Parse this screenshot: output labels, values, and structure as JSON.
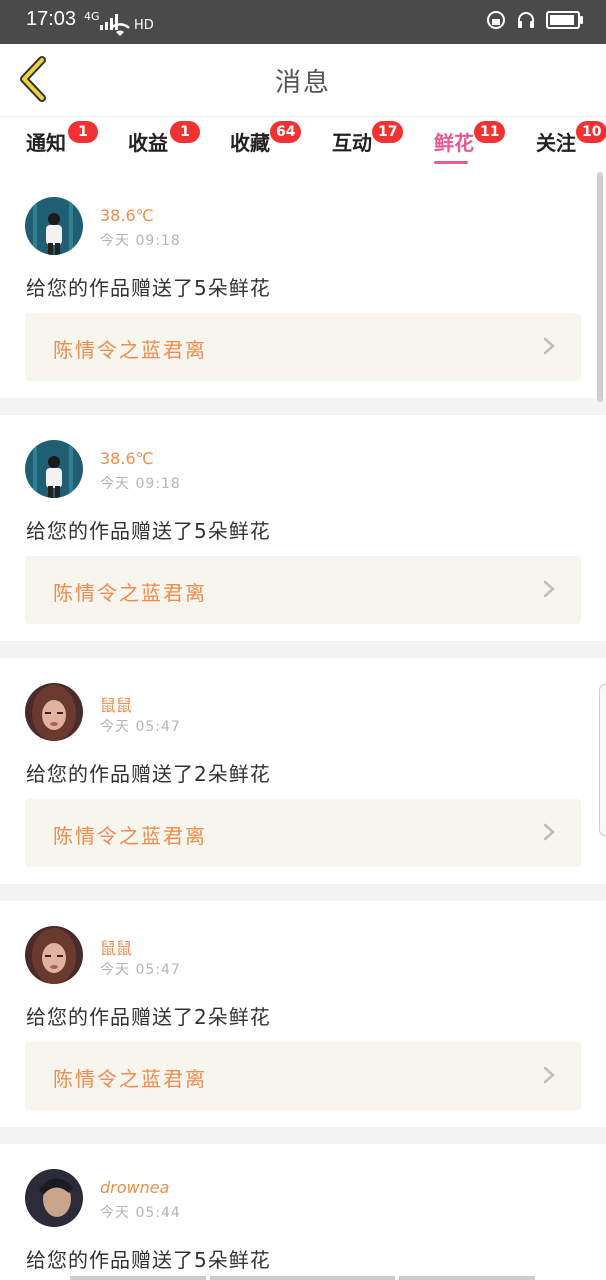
{
  "status_bar": {
    "time": "17:03",
    "signal": "4G",
    "network": "HD"
  },
  "header": {
    "title": "消息"
  },
  "tabs": [
    {
      "label": "通知",
      "badge": "1",
      "active": false
    },
    {
      "label": "收益",
      "badge": "1",
      "active": false
    },
    {
      "label": "收藏",
      "badge": "64",
      "active": false
    },
    {
      "label": "互动",
      "badge": "17",
      "active": false
    },
    {
      "label": "鲜花",
      "badge": "11",
      "active": true
    },
    {
      "label": "关注",
      "badge": "10",
      "active": false
    }
  ],
  "messages": [
    {
      "user": "38.6℃",
      "time": "今天 09:18",
      "text": "给您的作品赠送了5朵鲜花",
      "work": "陈情令之蓝君离"
    },
    {
      "user": "38.6℃",
      "time": "今天 09:18",
      "text": "给您的作品赠送了5朵鲜花",
      "work": "陈情令之蓝君离"
    },
    {
      "user": "鼠鼠",
      "time": "今天 05:47",
      "text": "给您的作品赠送了2朵鲜花",
      "work": "陈情令之蓝君离"
    },
    {
      "user": "鼠鼠",
      "time": "今天 05:47",
      "text": "给您的作品赠送了2朵鲜花",
      "work": "陈情令之蓝君离"
    },
    {
      "user": "drownea",
      "time": "今天 05:44",
      "text": "给您的作品赠送了5朵鲜花"
    }
  ],
  "colors": {
    "accent": "#e65b92",
    "badge": "#f23232",
    "username": "#f18c4c",
    "work_bg": "#f6f5ee"
  }
}
